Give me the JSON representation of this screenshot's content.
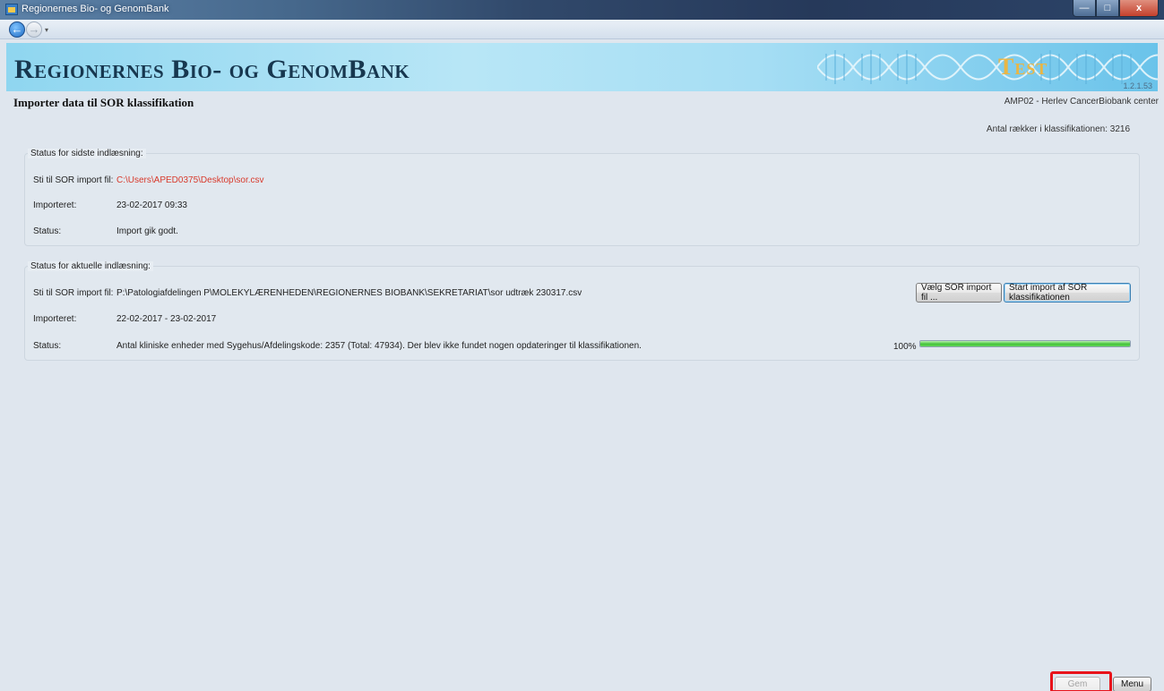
{
  "window": {
    "title": "Regionernes Bio- og GenomBank",
    "minimize": "—",
    "maximize": "□",
    "close": "x"
  },
  "nav": {
    "back": "←",
    "forward": "→",
    "dropdown": "▾"
  },
  "banner": {
    "brand": "Regionernes Bio- og GenomBank",
    "test_mark": "Test",
    "version": "1.2.1.53"
  },
  "page": {
    "title": "Importer data til SOR klassifikation",
    "center": "AMP02 - Herlev CancerBiobank center",
    "row_count": "Antal rækker i klassifikationen: 3216"
  },
  "last_import": {
    "legend": "Status for sidste indlæsning:",
    "path_label": "Sti til SOR import fil:",
    "path_value": "C:\\Users\\APED0375\\Desktop\\sor.csv",
    "imported_label": "Importeret:",
    "imported_value": "23-02-2017 09:33",
    "status_label": "Status:",
    "status_value": "Import gik godt."
  },
  "current_import": {
    "legend": "Status for aktuelle indlæsning:",
    "path_label": "Sti til SOR import fil:",
    "path_value": "P:\\Patologiafdelingen P\\MOLEKYLÆRENHEDEN\\REGIONERNES BIOBANK\\SEKRETARIAT\\sor udtræk 230317.csv",
    "choose_button": "Vælg SOR import fil ...",
    "start_button": "Start import af SOR klassifikationen",
    "imported_label": "Importeret:",
    "imported_value": "22-02-2017 - 23-02-2017",
    "status_label": "Status:",
    "status_value": "Antal kliniske enheder med Sygehus/Afdelingskode: 2357 (Total: 47934).  Der blev ikke fundet nogen opdateringer til klassifikationen.",
    "progress_label": "100%",
    "progress_fraction": 1.0
  },
  "footer": {
    "save_button": "Gem",
    "menu_button": "Menu"
  },
  "colors": {
    "path_red": "#d8392b",
    "highlight": "#e8131a",
    "progress_green": "#45c43a",
    "brand_text": "#17374f"
  }
}
